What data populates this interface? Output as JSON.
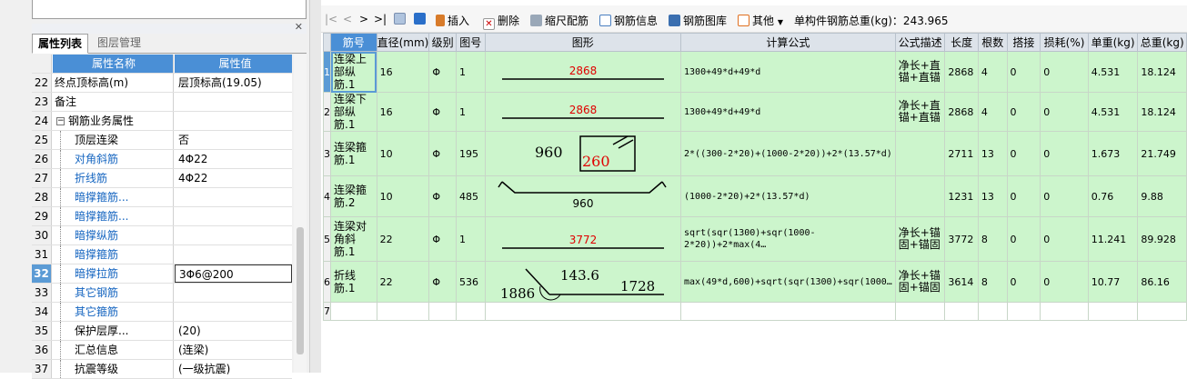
{
  "left_panel": {
    "tabs": [
      "属性列表",
      "图层管理"
    ],
    "header": {
      "name": "属性名称",
      "value": "属性值"
    },
    "rows": [
      {
        "n": "22",
        "name": "终点顶标高(m)",
        "value": "层顶标高(19.05)"
      },
      {
        "n": "23",
        "name": "备注",
        "value": ""
      },
      {
        "n": "24",
        "name": "钢筋业务属性",
        "value": ""
      },
      {
        "n": "25",
        "name": "顶层连梁",
        "value": "否"
      },
      {
        "n": "26",
        "name": "对角斜筋",
        "value": "4Φ22"
      },
      {
        "n": "27",
        "name": "折线筋",
        "value": "4Φ22"
      },
      {
        "n": "28",
        "name": "暗撑箍筋...",
        "value": ""
      },
      {
        "n": "29",
        "name": "暗撑箍筋...",
        "value": ""
      },
      {
        "n": "30",
        "name": "暗撑纵筋",
        "value": ""
      },
      {
        "n": "31",
        "name": "暗撑箍筋",
        "value": ""
      },
      {
        "n": "32",
        "name": "暗撑拉筋",
        "value": "3Φ6@200"
      },
      {
        "n": "33",
        "name": "其它钢筋",
        "value": ""
      },
      {
        "n": "34",
        "name": "其它箍筋",
        "value": ""
      },
      {
        "n": "35",
        "name": "保护层厚...",
        "value": "(20)"
      },
      {
        "n": "36",
        "name": "汇总信息",
        "value": "(连梁)"
      },
      {
        "n": "37",
        "name": "抗震等级",
        "value": "(一级抗震)"
      }
    ]
  },
  "toolbar": {
    "nav": [
      "|<",
      "<",
      ">",
      ">|"
    ],
    "insert": "插入",
    "delete": "删除",
    "scale": "缩尺配筋",
    "info": "钢筋信息",
    "library": "钢筋图库",
    "other": "其他",
    "total": "单构件钢筋总重(kg)：243.965"
  },
  "table": {
    "headers": [
      "筋号",
      "直径(mm)",
      "级别",
      "图号",
      "图形",
      "计算公式",
      "公式描述",
      "长度",
      "根数",
      "搭接",
      "损耗(%)",
      "单重(kg)",
      "总重(kg)"
    ],
    "rows": [
      {
        "n": "1",
        "name": "连梁上部纵筋.1",
        "dia": "16",
        "grade": "Φ",
        "fig": "1",
        "s1": "2868",
        "s2": "",
        "s3": "",
        "s4": "",
        "formula": "1300+49*d+49*d",
        "desc": "净长+直锚+直锚",
        "len": "2868",
        "count": "4",
        "lap": "0",
        "loss": "0",
        "unit": "4.531",
        "total": "18.124"
      },
      {
        "n": "2",
        "name": "连梁下部纵筋.1",
        "dia": "16",
        "grade": "Φ",
        "fig": "1",
        "s1": "2868",
        "s2": "",
        "s3": "",
        "s4": "",
        "formula": "1300+49*d+49*d",
        "desc": "净长+直锚+直锚",
        "len": "2868",
        "count": "4",
        "lap": "0",
        "loss": "0",
        "unit": "4.531",
        "total": "18.124"
      },
      {
        "n": "3",
        "name": "连梁箍筋.1",
        "dia": "10",
        "grade": "Φ",
        "fig": "195",
        "s1": "960",
        "s2": "260",
        "s3": "",
        "s4": "",
        "formula": "2*((300-2*20)+(1000-2*20))+2*(13.57*d)",
        "desc": "",
        "len": "2711",
        "count": "13",
        "lap": "0",
        "loss": "0",
        "unit": "1.673",
        "total": "21.749"
      },
      {
        "n": "4",
        "name": "连梁箍筋.2",
        "dia": "10",
        "grade": "Φ",
        "fig": "485",
        "s1": "960",
        "s2": "",
        "s3": "",
        "s4": "",
        "formula": "(1000-2*20)+2*(13.57*d)",
        "desc": "",
        "len": "1231",
        "count": "13",
        "lap": "0",
        "loss": "0",
        "unit": "0.76",
        "total": "9.88"
      },
      {
        "n": "5",
        "name": "连梁对角斜筋.1",
        "dia": "22",
        "grade": "Φ",
        "fig": "1",
        "s1": "3772",
        "s2": "",
        "s3": "",
        "s4": "",
        "formula": "sqrt(sqr(1300)+sqr(1000-2*20))+2*max(4…",
        "desc": "净长+锚固+锚固",
        "len": "3772",
        "count": "8",
        "lap": "0",
        "loss": "0",
        "unit": "11.241",
        "total": "89.928"
      },
      {
        "n": "6",
        "name": "折线筋.1",
        "dia": "22",
        "grade": "Φ",
        "fig": "536",
        "s1": "143.6",
        "s2": "1728",
        "s3": "1886",
        "s4": "",
        "formula": "max(49*d,600)+sqrt(sqr(1300)+sqr(1000…",
        "desc": "净长+锚固+锚固",
        "len": "3614",
        "count": "8",
        "lap": "0",
        "loss": "0",
        "unit": "10.77",
        "total": "86.16"
      }
    ],
    "empty_row": "7"
  }
}
